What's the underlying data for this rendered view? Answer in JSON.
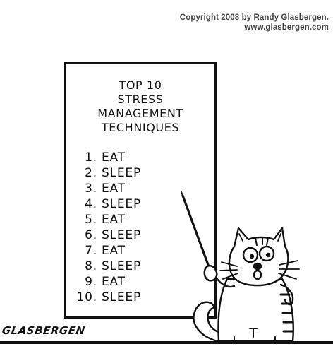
{
  "copyright": {
    "line1": "Copyright 2008 by Randy Glasbergen.",
    "line2": "www.glasbergen.com"
  },
  "board": {
    "title_lines": [
      "TOP 10",
      "STRESS",
      "MANAGEMENT",
      "TECHNIQUES"
    ],
    "items": [
      {
        "num": "1.",
        "text": "EAT"
      },
      {
        "num": "2.",
        "text": "SLEEP"
      },
      {
        "num": "3.",
        "text": "EAT"
      },
      {
        "num": "4.",
        "text": "SLEEP"
      },
      {
        "num": "5.",
        "text": "EAT"
      },
      {
        "num": "6.",
        "text": "SLEEP"
      },
      {
        "num": "7.",
        "text": "EAT"
      },
      {
        "num": "8.",
        "text": "SLEEP"
      },
      {
        "num": "9.",
        "text": "EAT"
      },
      {
        "num": "10.",
        "text": "SLEEP"
      }
    ]
  },
  "signature": "GLASBERGEN",
  "colors": {
    "ink": "#111111",
    "paper": "#ffffff",
    "copyright_text": "#444444"
  }
}
